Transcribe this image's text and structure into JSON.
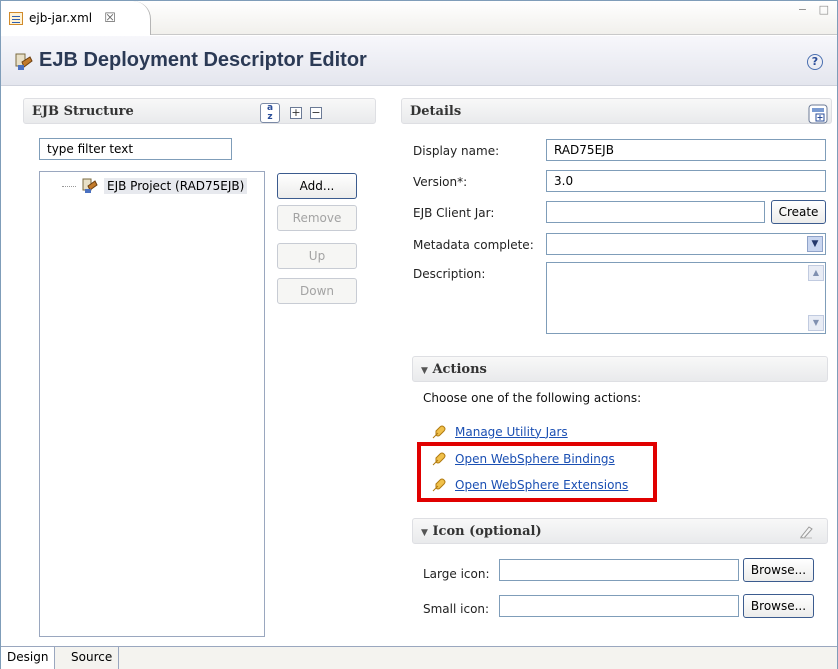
{
  "editor_tab": {
    "label": "ejb-jar.xml",
    "close_glyph": "☒"
  },
  "window_controls": "− □",
  "header": {
    "title": "EJB Deployment Descriptor Editor",
    "help_glyph": "?"
  },
  "ejb_structure": {
    "title": "EJB Structure",
    "filter_placeholder": "type filter text",
    "expand_glyph": "+",
    "collapse_glyph": "−",
    "tree": [
      {
        "label": "EJB Project (RAD75EJB)",
        "icon": "ejb-project-icon"
      }
    ],
    "buttons": {
      "add": "Add...",
      "remove": "Remove",
      "up": "Up",
      "down": "Down"
    }
  },
  "details": {
    "title": "Details",
    "display_name_label": "Display name:",
    "display_name_value": "RAD75EJB",
    "version_label": "Version*:",
    "version_value": "3.0",
    "client_jar_label": "EJB Client Jar:",
    "client_jar_value": "",
    "create_label": "Create",
    "metadata_label": "Metadata complete:",
    "metadata_value": "",
    "description_label": "Description:"
  },
  "actions": {
    "title": "Actions",
    "toggle_glyph": "▼",
    "prompt": "Choose one of the following actions:",
    "links": [
      {
        "label": "Manage Utility Jars",
        "icon": "link-icon"
      },
      {
        "label": "Open WebSphere Bindings",
        "icon": "link-icon"
      },
      {
        "label": "Open WebSphere Extensions",
        "icon": "link-icon"
      }
    ],
    "highlight_color": "#e00000"
  },
  "icon_section": {
    "title": "Icon (optional)",
    "toggle_glyph": "▼",
    "large_label": "Large icon:",
    "small_label": "Small icon:",
    "browse_label": "Browse..."
  },
  "bottom_tabs": [
    "Design",
    "Source"
  ]
}
